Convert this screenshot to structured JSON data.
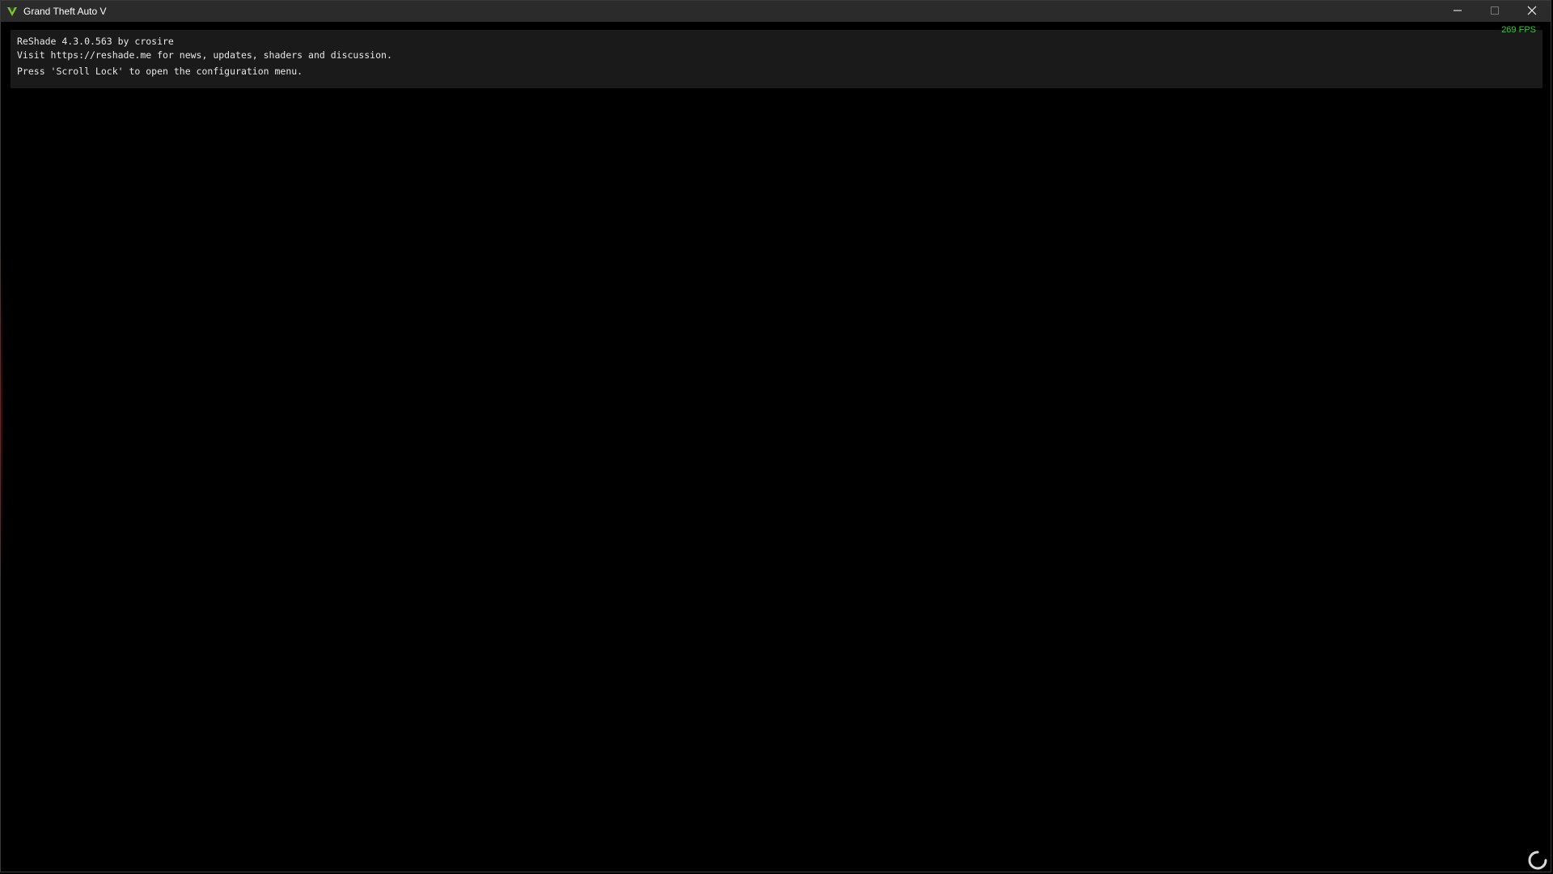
{
  "window": {
    "title": "Grand Theft Auto V",
    "icon": "gta-v-icon",
    "controls": {
      "minimize": "minimize-icon",
      "maximize": "maximize-icon",
      "close": "close-icon"
    }
  },
  "overlay": {
    "line1": "ReShade 4.3.0.563 by crosire",
    "line2": "Visit https://reshade.me for news, updates, shaders and discussion.",
    "line3": "Press 'Scroll Lock' to open the configuration menu.",
    "fps": "269 FPS",
    "fps_color": "#2bd22b"
  },
  "loading": {
    "icon": "loading-spinner-icon"
  }
}
